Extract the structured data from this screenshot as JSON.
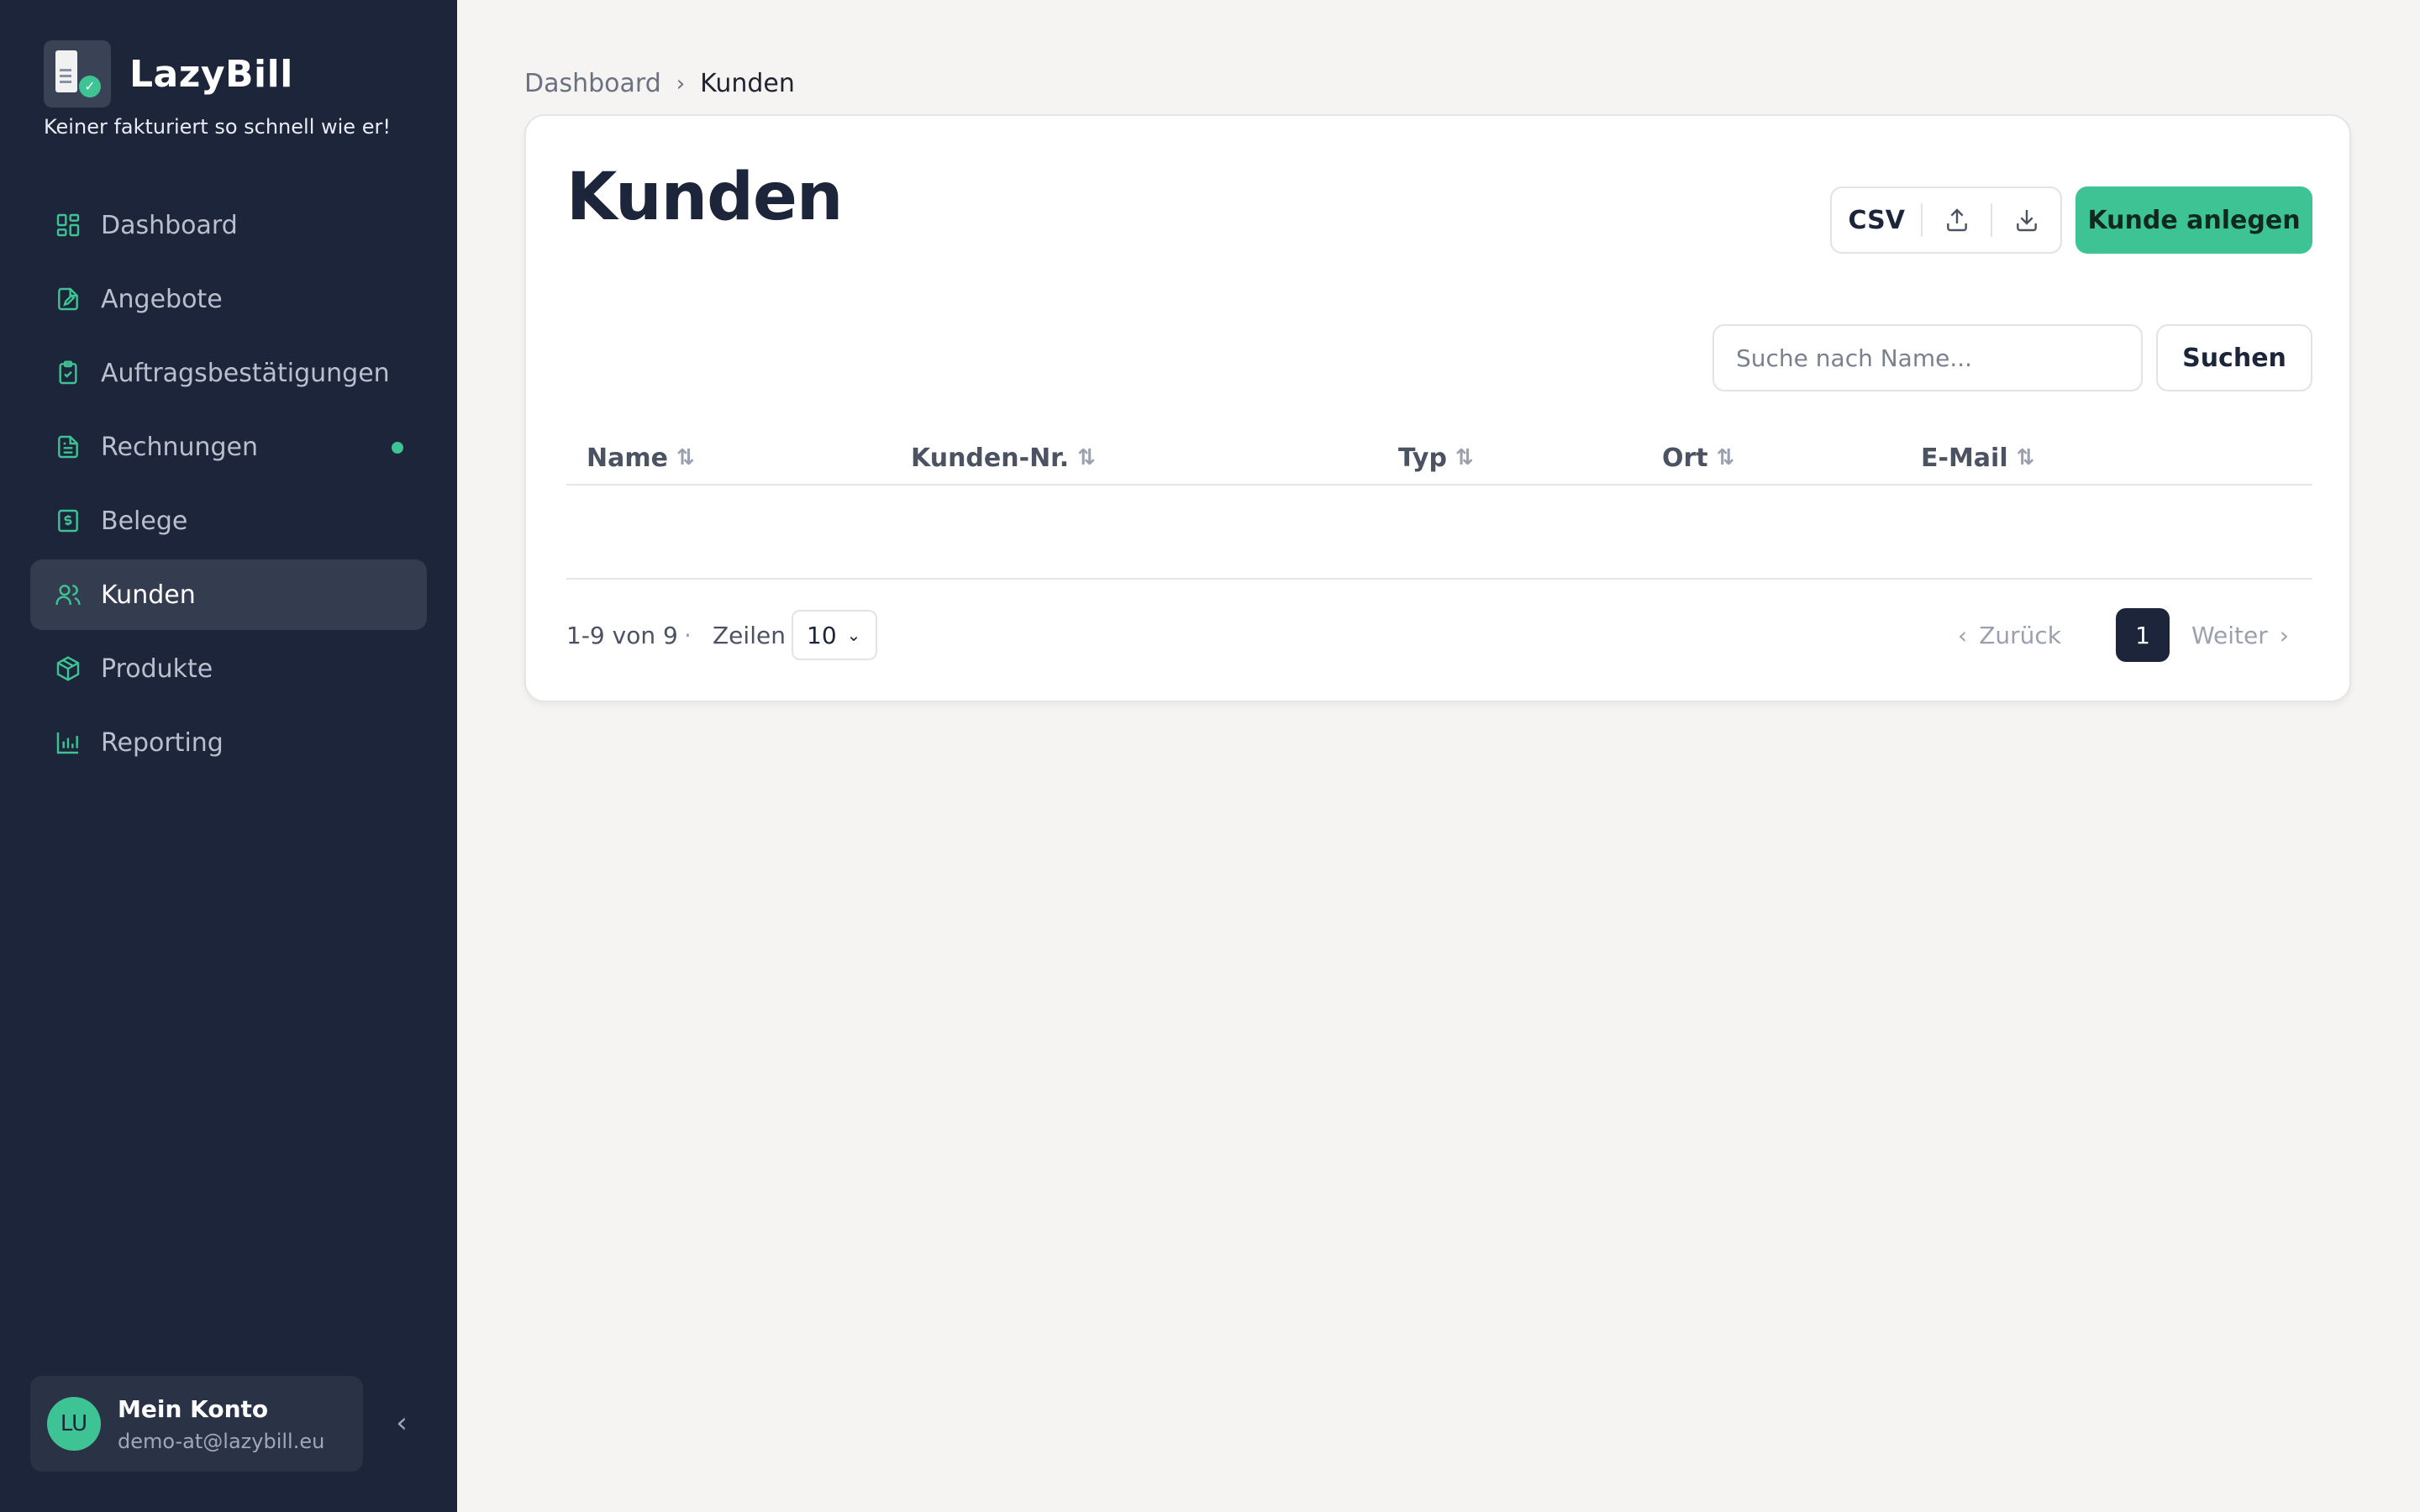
{
  "app": {
    "name": "LazyBill",
    "tagline": "Keiner fakturiert so schnell wie er!"
  },
  "sidebar": {
    "items": [
      {
        "label": "Dashboard",
        "icon": "dashboard-grid-icon"
      },
      {
        "label": "Angebote",
        "icon": "file-edit-icon"
      },
      {
        "label": "Auftragsbestätigungen",
        "icon": "clipboard-check-icon"
      },
      {
        "label": "Rechnungen",
        "icon": "file-text-icon",
        "has_dot": true
      },
      {
        "label": "Belege",
        "icon": "receipt-icon"
      },
      {
        "label": "Kunden",
        "icon": "users-icon",
        "active": true
      },
      {
        "label": "Produkte",
        "icon": "package-icon"
      },
      {
        "label": "Reporting",
        "icon": "bar-chart-icon"
      }
    ],
    "account": {
      "initials": "LU",
      "name": "Mein Konto",
      "email": "demo-at@lazybill.eu"
    }
  },
  "breadcrumb": {
    "parent": "Dashboard",
    "current": "Kunden"
  },
  "page": {
    "title": "Kunden",
    "csv_label": "CSV",
    "create_button": "Kunde anlegen",
    "search_placeholder": "Suche nach Name...",
    "search_button": "Suchen"
  },
  "table": {
    "columns": [
      "Name",
      "Kunden-Nr.",
      "Typ",
      "Ort",
      "E-Mail"
    ],
    "rows": []
  },
  "pagination": {
    "count_text": "1-9 von 9",
    "separator": "·",
    "rows_label": "Zeilen",
    "rows_value": "10",
    "prev_label": "Zurück",
    "current_page": "1",
    "next_label": "Weiter"
  },
  "colors": {
    "sidebar_bg": "#1c2539",
    "accent": "#3ec494",
    "page_bg": "#f5f4f2"
  }
}
